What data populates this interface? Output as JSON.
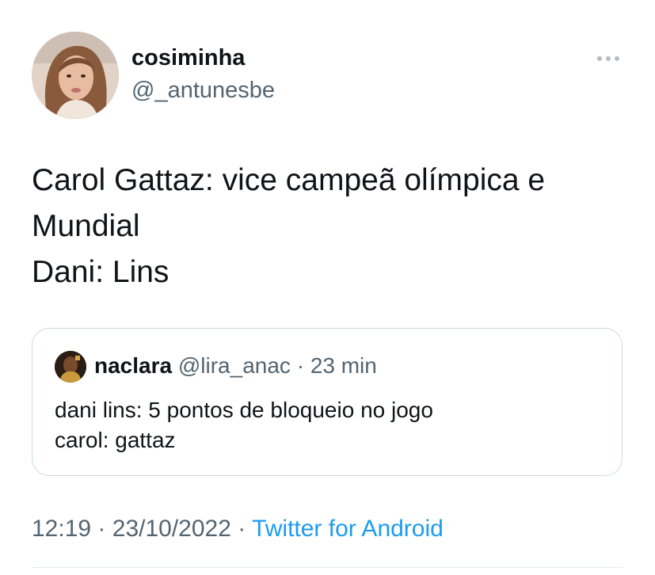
{
  "tweet": {
    "author": {
      "display_name": "cosiminha",
      "handle": "@_antunesbe"
    },
    "text_lines": [
      "Carol Gattaz: vice campeã olímpica e",
      "Mundial",
      "Dani: Lins"
    ],
    "more_icon": "more-horizontal-icon",
    "quoted": {
      "display_name": "naclara",
      "handle": "@lira_anac",
      "separator": "·",
      "time": "23 min",
      "text_lines": [
        "dani lins: 5 pontos de bloqueio no jogo",
        "carol: gattaz"
      ]
    },
    "time": "12:19",
    "separator": "·",
    "date": "23/10/2022",
    "source": "Twitter for Android"
  },
  "colors": {
    "text": "#0f1419",
    "secondary": "#536471",
    "link": "#1d9bf0",
    "border": "#cfd9de"
  }
}
